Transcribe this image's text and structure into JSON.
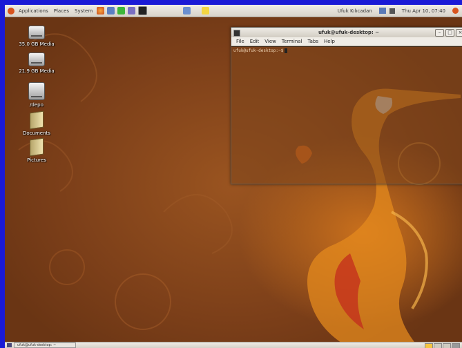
{
  "top_panel": {
    "menus": [
      "Applications",
      "Places",
      "System"
    ],
    "user": "Ufuk Kılıcadan",
    "datetime": "Thu Apr 10, 07:40"
  },
  "desktop": {
    "icons": [
      {
        "label": "35.0 GB Media",
        "type": "drive"
      },
      {
        "label": "21.9 GB Media",
        "type": "drive"
      },
      {
        "label": "/depo",
        "type": "drive"
      },
      {
        "label": "Documents",
        "type": "folder"
      },
      {
        "label": "Pictures",
        "type": "folder"
      }
    ]
  },
  "terminal": {
    "title": "ufuk@ufuk-desktop: ~",
    "menu": [
      "File",
      "Edit",
      "View",
      "Terminal",
      "Tabs",
      "Help"
    ],
    "prompt": "ufuk@ufuk-desktop:~$",
    "buttons": {
      "minimize": "–",
      "maximize": "□",
      "close": "×"
    }
  },
  "bottom_panel": {
    "task": "ufuk@ufuk-desktop: ~"
  },
  "colors": {
    "desktop": "#8a4a1c",
    "panel": "#e6e2db",
    "frame": "#1a1ad6"
  }
}
